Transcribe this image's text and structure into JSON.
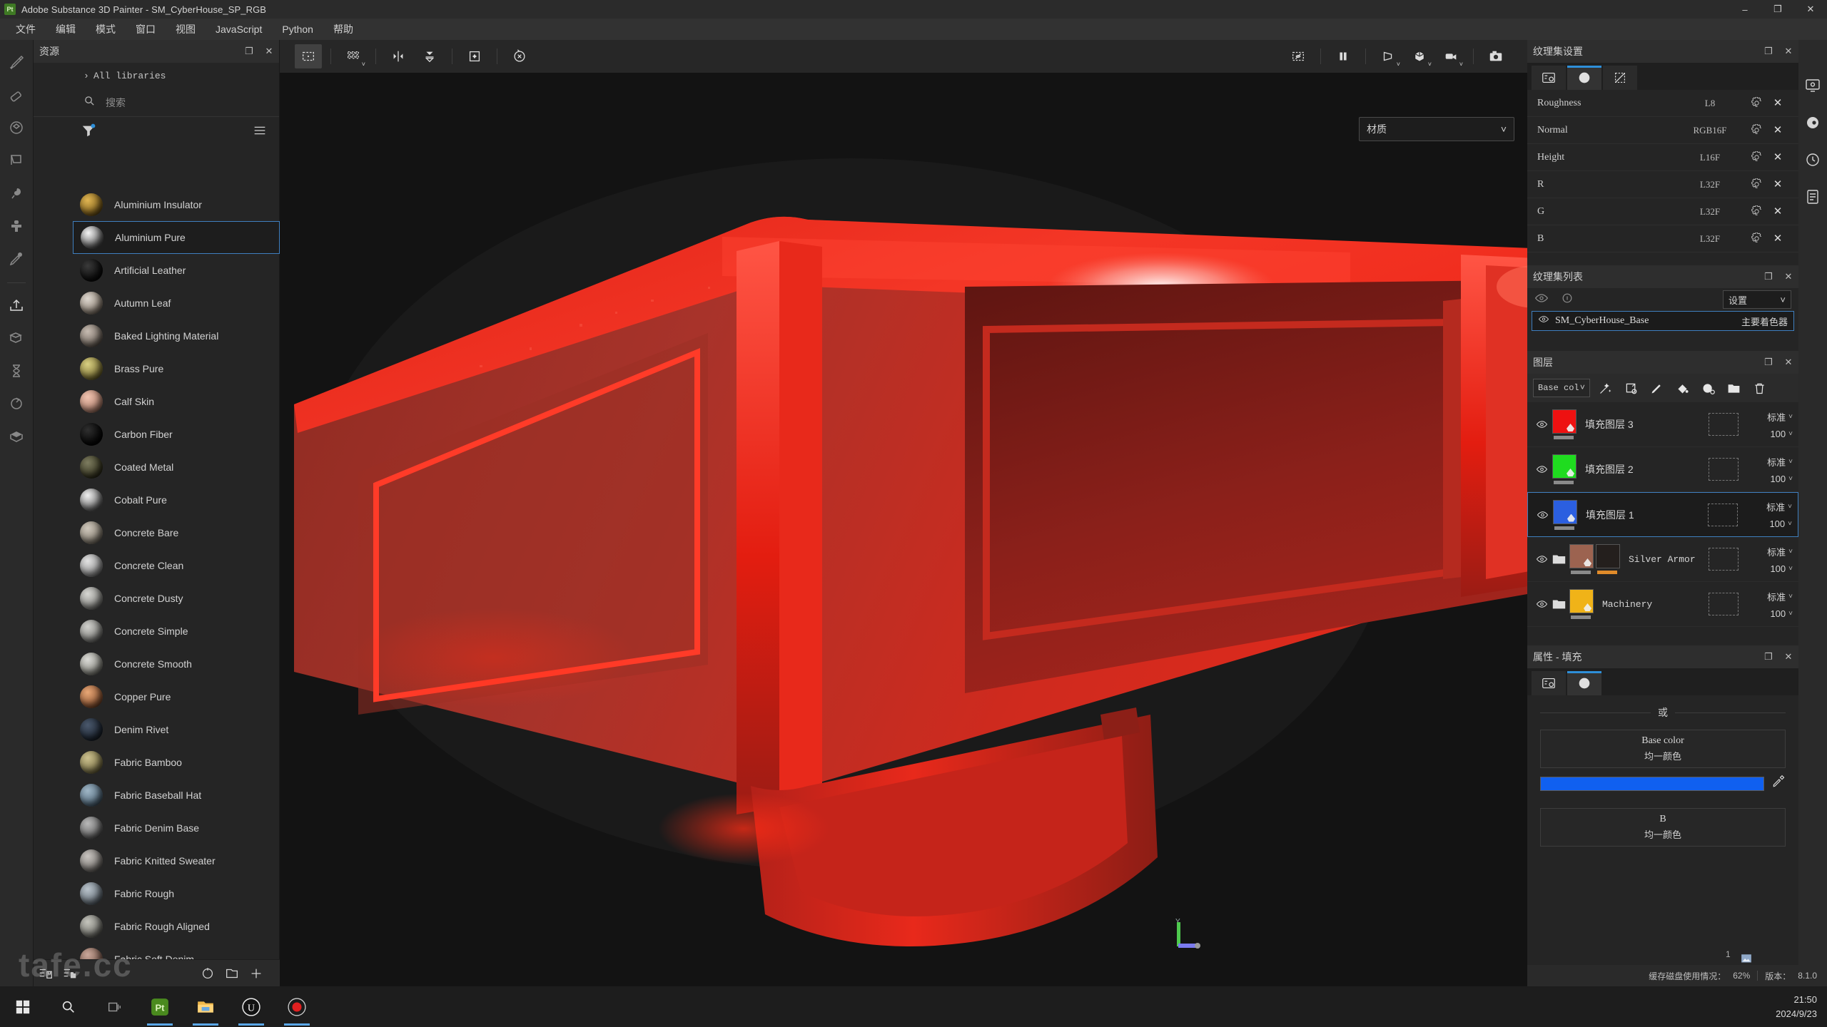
{
  "window": {
    "title": "Adobe Substance 3D Painter - SM_CyberHouse_SP_RGB",
    "app_icon": "Pt",
    "minimize": "–",
    "maximize": "❐",
    "close": "✕"
  },
  "menubar": {
    "items": [
      {
        "label": "文件",
        "name": "menu-file"
      },
      {
        "label": "编辑",
        "name": "menu-edit"
      },
      {
        "label": "模式",
        "name": "menu-mode"
      },
      {
        "label": "窗口",
        "name": "menu-window"
      },
      {
        "label": "视图",
        "name": "menu-view"
      },
      {
        "label": "JavaScript",
        "name": "menu-javascript"
      },
      {
        "label": "Python",
        "name": "menu-python"
      },
      {
        "label": "帮助",
        "name": "menu-help"
      }
    ]
  },
  "left_rail": {
    "tools": [
      {
        "name": "paint-brush-icon"
      },
      {
        "name": "eraser-icon"
      },
      {
        "name": "projection-icon"
      },
      {
        "name": "geometry-decal-icon"
      },
      {
        "name": "smudge-icon"
      },
      {
        "name": "clone-stamp-icon"
      },
      {
        "name": "material-picker-icon"
      },
      {
        "name": "export-icon"
      },
      {
        "name": "bake-mesh-maps-icon"
      },
      {
        "name": "hourglass-icon"
      },
      {
        "name": "refresh-icon"
      },
      {
        "name": "3d-view-icon"
      }
    ]
  },
  "assets": {
    "title": "资源",
    "dock_icon": "❐",
    "close_icon": "✕",
    "library_label": "All libraries",
    "search_placeholder": "搜索",
    "search_value": "",
    "filter_icon": "filter-icon",
    "list_icon": "list-view-icon",
    "materials": [
      {
        "label": "Aluminium Insulator",
        "color1": "#e0b552",
        "color2": "#7a5c1a",
        "selected": false
      },
      {
        "label": "Aluminium Pure",
        "color1": "#f4f4f4",
        "color2": "#5d5d5d",
        "selected": true
      },
      {
        "label": "Artificial Leather",
        "color1": "#3a3a3a",
        "color2": "#0a0a0a",
        "selected": false
      },
      {
        "label": "Autumn Leaf",
        "color1": "#ddd7cf",
        "color2": "#8b7f72",
        "selected": false
      },
      {
        "label": "Baked Lighting Material",
        "color1": "#c6bbb1",
        "color2": "#6f655c",
        "selected": false
      },
      {
        "label": "Brass Pure",
        "color1": "#d8cf82",
        "color2": "#7b7032",
        "selected": false
      },
      {
        "label": "Calf Skin",
        "color1": "#f0c3b0",
        "color2": "#b07f6c",
        "selected": false
      },
      {
        "label": "Carbon Fiber",
        "color1": "#2f2f2f",
        "color2": "#040404",
        "selected": false
      },
      {
        "label": "Coated Metal",
        "color1": "#7d7c60",
        "color2": "#35341f",
        "selected": false
      },
      {
        "label": "Cobalt Pure",
        "color1": "#efefef",
        "color2": "#6a6a6a",
        "selected": false
      },
      {
        "label": "Concrete Bare",
        "color1": "#cfc8bc",
        "color2": "#857d70",
        "selected": false
      },
      {
        "label": "Concrete Clean",
        "color1": "#e2e2e2",
        "color2": "#8d8d8d",
        "selected": false
      },
      {
        "label": "Concrete Dusty",
        "color1": "#d6d6d2",
        "color2": "#848480",
        "selected": false
      },
      {
        "label": "Concrete Simple",
        "color1": "#d0d0cc",
        "color2": "#7e7e7a",
        "selected": false
      },
      {
        "label": "Concrete Smooth",
        "color1": "#dadad6",
        "color2": "#87877f",
        "selected": false
      },
      {
        "label": "Copper Pure",
        "color1": "#e8a776",
        "color2": "#8c5432",
        "selected": false
      },
      {
        "label": "Denim Rivet",
        "color1": "#4a586c",
        "color2": "#1d2530",
        "selected": false
      },
      {
        "label": "Fabric Bamboo",
        "color1": "#cbc08e",
        "color2": "#7c7347",
        "selected": false
      },
      {
        "label": "Fabric Baseball Hat",
        "color1": "#9fb6c6",
        "color2": "#51687a",
        "selected": false
      },
      {
        "label": "Fabric Denim Base",
        "color1": "#b8b8b8",
        "color2": "#636363",
        "selected": false
      },
      {
        "label": "Fabric Knitted Sweater",
        "color1": "#c8c4c0",
        "color2": "#76726e",
        "selected": false
      },
      {
        "label": "Fabric Rough",
        "color1": "#b9c3cb",
        "color2": "#656f78",
        "selected": false
      },
      {
        "label": "Fabric Rough Aligned",
        "color1": "#c4c4bc",
        "color2": "#70706a",
        "selected": false
      },
      {
        "label": "Fabric Soft Denim",
        "color1": "#c9a79a",
        "color2": "#7a5a4d",
        "selected": false
      }
    ],
    "footer": [
      {
        "name": "save-preset-icon"
      },
      {
        "name": "open-folder-list-icon"
      },
      {
        "name": "reset-icon"
      },
      {
        "name": "new-folder-icon"
      },
      {
        "name": "add-icon"
      }
    ]
  },
  "viewport": {
    "toolbar_left": [
      {
        "name": "selection-marquee-icon",
        "active": true
      },
      {
        "name": "uv-grid-icon",
        "active": false
      },
      {
        "name": "symmetry-icon",
        "active": false
      },
      {
        "name": "symmetry-plane-icon",
        "active": false
      },
      {
        "name": "add-anchor-icon",
        "active": false
      },
      {
        "name": "reset-transform-icon",
        "active": false
      }
    ],
    "toolbar_right": [
      {
        "name": "hide-selection-icon"
      },
      {
        "name": "pause-icon"
      },
      {
        "name": "shader-view-icon"
      },
      {
        "name": "mesh-view-icon"
      },
      {
        "name": "camera-view-icon"
      },
      {
        "name": "screenshot-icon"
      }
    ],
    "material_dropdown": "材质",
    "gizmo_axis_y": "Y"
  },
  "texture_set_settings": {
    "title": "纹理集设置",
    "dock_icon": "❐",
    "close_icon": "✕",
    "tabs": [
      {
        "name": "settings-tab-icon",
        "active": false
      },
      {
        "name": "material-tab-icon",
        "active": true
      },
      {
        "name": "mesh-maps-tab-icon",
        "active": false
      }
    ],
    "channels": [
      {
        "name": "Roughness",
        "format": "L8"
      },
      {
        "name": "Normal",
        "format": "RGB16F"
      },
      {
        "name": "Height",
        "format": "L16F"
      },
      {
        "name": "R",
        "format": "L32F"
      },
      {
        "name": "G",
        "format": "L32F"
      },
      {
        "name": "B",
        "format": "L32F"
      }
    ]
  },
  "texture_set_list": {
    "title": "纹理集列表",
    "dock_icon": "❐",
    "close_icon": "✕",
    "settings_dropdown": "设置",
    "items": [
      {
        "name": "SM_CyberHouse_Base",
        "shader": "主要着色器",
        "selected": true
      }
    ]
  },
  "layers": {
    "title": "图层",
    "dock_icon": "❐",
    "close_icon": "✕",
    "channel_dropdown": "Base col",
    "tools": [
      {
        "name": "magic-wand-icon"
      },
      {
        "name": "add-smart-mask-icon"
      },
      {
        "name": "add-paint-layer-icon"
      },
      {
        "name": "add-fill-layer-icon"
      },
      {
        "name": "add-effect-icon"
      },
      {
        "name": "add-folder-icon"
      },
      {
        "name": "delete-layer-icon"
      }
    ],
    "rows": [
      {
        "label": "填充图层 3",
        "color": "#ee1111",
        "blend": "标准",
        "opacity": "100",
        "selected": false,
        "folder": false,
        "mono": false,
        "underbar": "#8a8a8a"
      },
      {
        "label": "填充图层 2",
        "color": "#1fdc1f",
        "blend": "标准",
        "opacity": "100",
        "selected": false,
        "folder": false,
        "mono": false,
        "underbar": "#8a8a8a"
      },
      {
        "label": "填充图层 1",
        "color": "#2b5fe0",
        "blend": "标准",
        "opacity": "100",
        "selected": true,
        "folder": false,
        "mono": false,
        "underbar": "#8a8a8a"
      },
      {
        "label": "Silver Armor",
        "color": "#9c6350",
        "blend": "标准",
        "opacity": "100",
        "selected": false,
        "folder": true,
        "mono": true,
        "underbar": "#8a8a8a",
        "extra_thumb": "#241f1d",
        "extra_bar": "#e08b2a"
      },
      {
        "label": "Machinery",
        "color": "#f0b318",
        "blend": "标准",
        "opacity": "100",
        "selected": false,
        "folder": true,
        "mono": true,
        "underbar": "#8a8a8a"
      }
    ]
  },
  "properties": {
    "title": "属性 - 填充",
    "dock_icon": "❐",
    "close_icon": "✕",
    "tabs": [
      {
        "name": "settings-tab-icon",
        "active": false
      },
      {
        "name": "material-tab-icon",
        "active": true
      }
    ],
    "or_label": "或",
    "fields": [
      {
        "title": "Base color",
        "subtitle": "均一颜色",
        "swatch": "#1060f0",
        "has_color": true
      },
      {
        "title": "B",
        "subtitle": "均一颜色",
        "swatch": "",
        "has_color": false
      }
    ],
    "page_number": "1"
  },
  "right_rail": {
    "items": [
      {
        "name": "display-settings-icon"
      },
      {
        "name": "shader-settings-icon"
      },
      {
        "name": "history-icon"
      },
      {
        "name": "log-icon"
      }
    ]
  },
  "statusbar": {
    "cache_label": "缓存磁盘使用情况：",
    "cache_value": "62%",
    "version_label": "版本：",
    "version_value": "8.1.0"
  },
  "taskbar": {
    "watermark": "tafe.cc",
    "items": [
      {
        "name": "start-button-icon",
        "running": false
      },
      {
        "name": "search-icon",
        "running": false
      },
      {
        "name": "task-view-icon",
        "running": false
      },
      {
        "name": "substance-painter-taskbar-icon",
        "running": true
      },
      {
        "name": "file-explorer-taskbar-icon",
        "running": true
      },
      {
        "name": "unreal-engine-taskbar-icon",
        "running": true
      },
      {
        "name": "screen-recorder-taskbar-icon",
        "running": true
      }
    ],
    "time": "21:50",
    "date": "2024/9/23"
  }
}
